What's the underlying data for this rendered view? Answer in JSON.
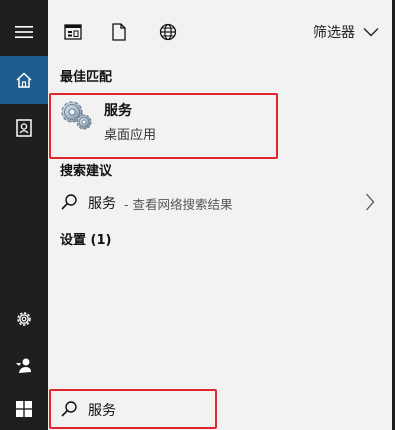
{
  "toolbar": {
    "icons": [
      "app-list-icon",
      "document-icon",
      "globe-icon"
    ],
    "filter_label": "筛选器"
  },
  "best_match": {
    "section_title": "最佳匹配",
    "name": "服务",
    "type": "桌面应用",
    "icon": "services-gears-icon"
  },
  "suggestions": {
    "section_title": "搜索建议",
    "items": [
      {
        "term": "服务",
        "hint": "- 查看网络搜索结果"
      }
    ]
  },
  "settings": {
    "label": "设置 (1)"
  },
  "rail": {
    "icons": [
      "hamburger-icon",
      "home-icon",
      "portrait-icon",
      "gear-icon",
      "feedback-icon"
    ]
  },
  "taskbar": {
    "search_value": "服务",
    "start_icon": "windows-logo-icon"
  },
  "colors": {
    "rail_bg": "#1f1f1f",
    "active_blue": "#1e5d8e",
    "panel_bg": "#f2f2f2",
    "highlight_red": "#e0262e"
  }
}
